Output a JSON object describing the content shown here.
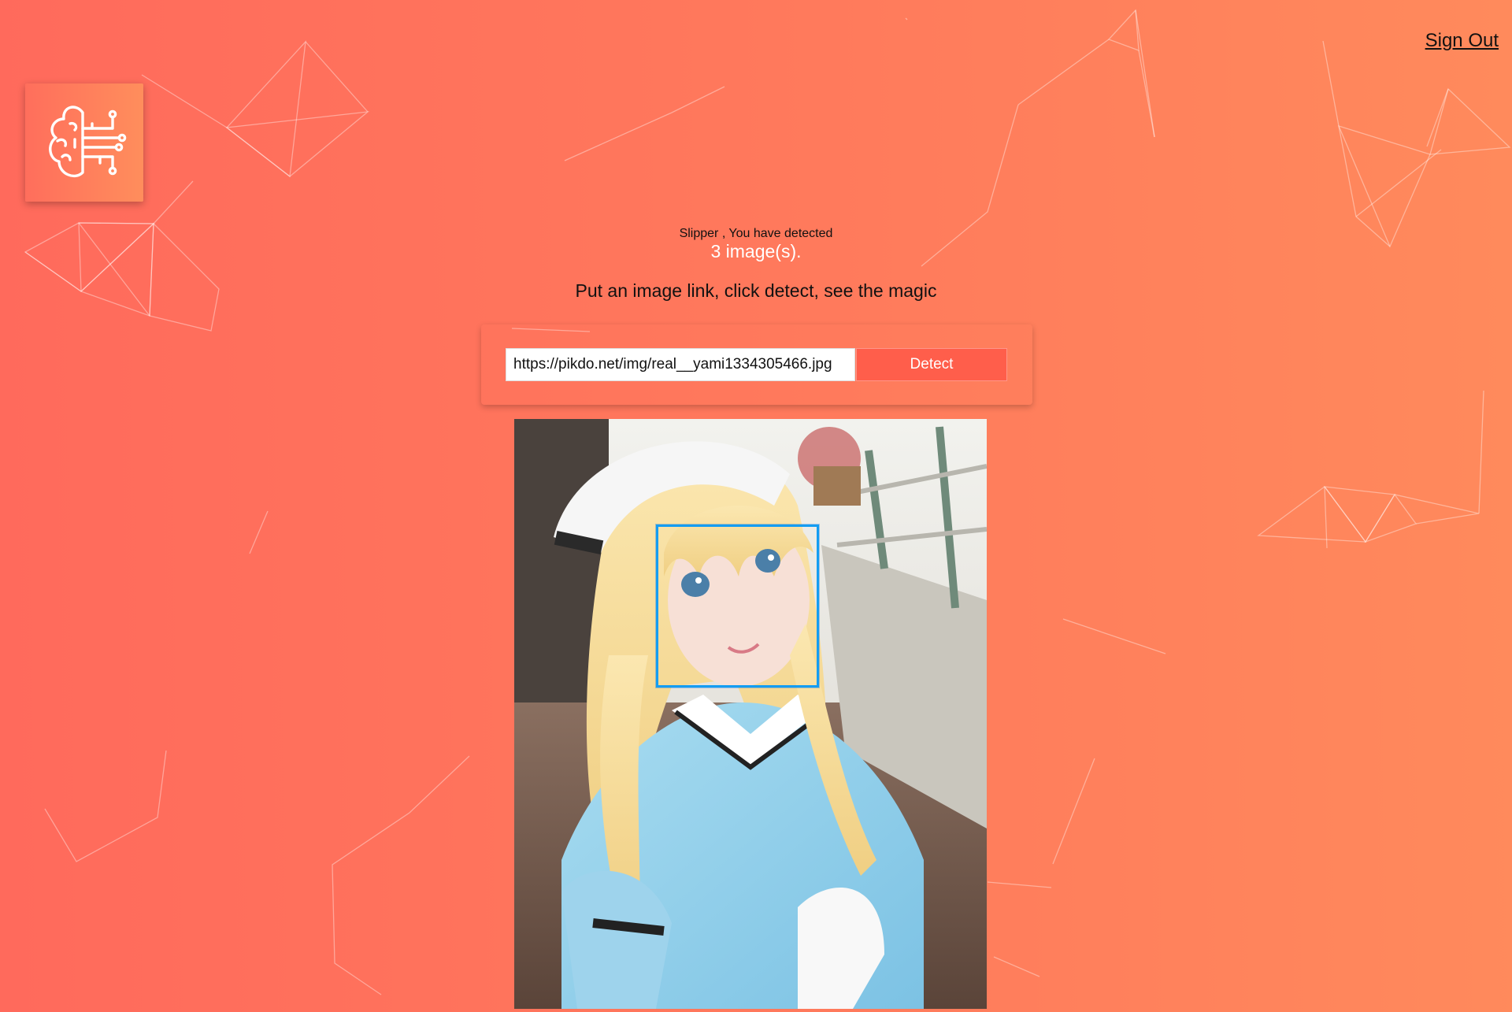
{
  "header": {
    "sign_out_label": "Sign Out"
  },
  "logo": {
    "icon": "brain-circuit-icon"
  },
  "status": {
    "greeting": "Slipper , You have detected",
    "count_text": "3 image(s)."
  },
  "tagline": "Put an image link, click detect, see the magic",
  "form": {
    "url_value": "https://pikdo.net/img/real__yami1334305466.jpg",
    "detect_label": "Detect"
  },
  "result": {
    "image_alt": "Detected image: cosplayer in maid outfit on a balcony",
    "face_box_color": "#149df2",
    "faces_detected": 1
  },
  "colors": {
    "background_start": "#ff6a5c",
    "background_end": "#ff8a5c",
    "detect_button": "#ff5e4b"
  }
}
